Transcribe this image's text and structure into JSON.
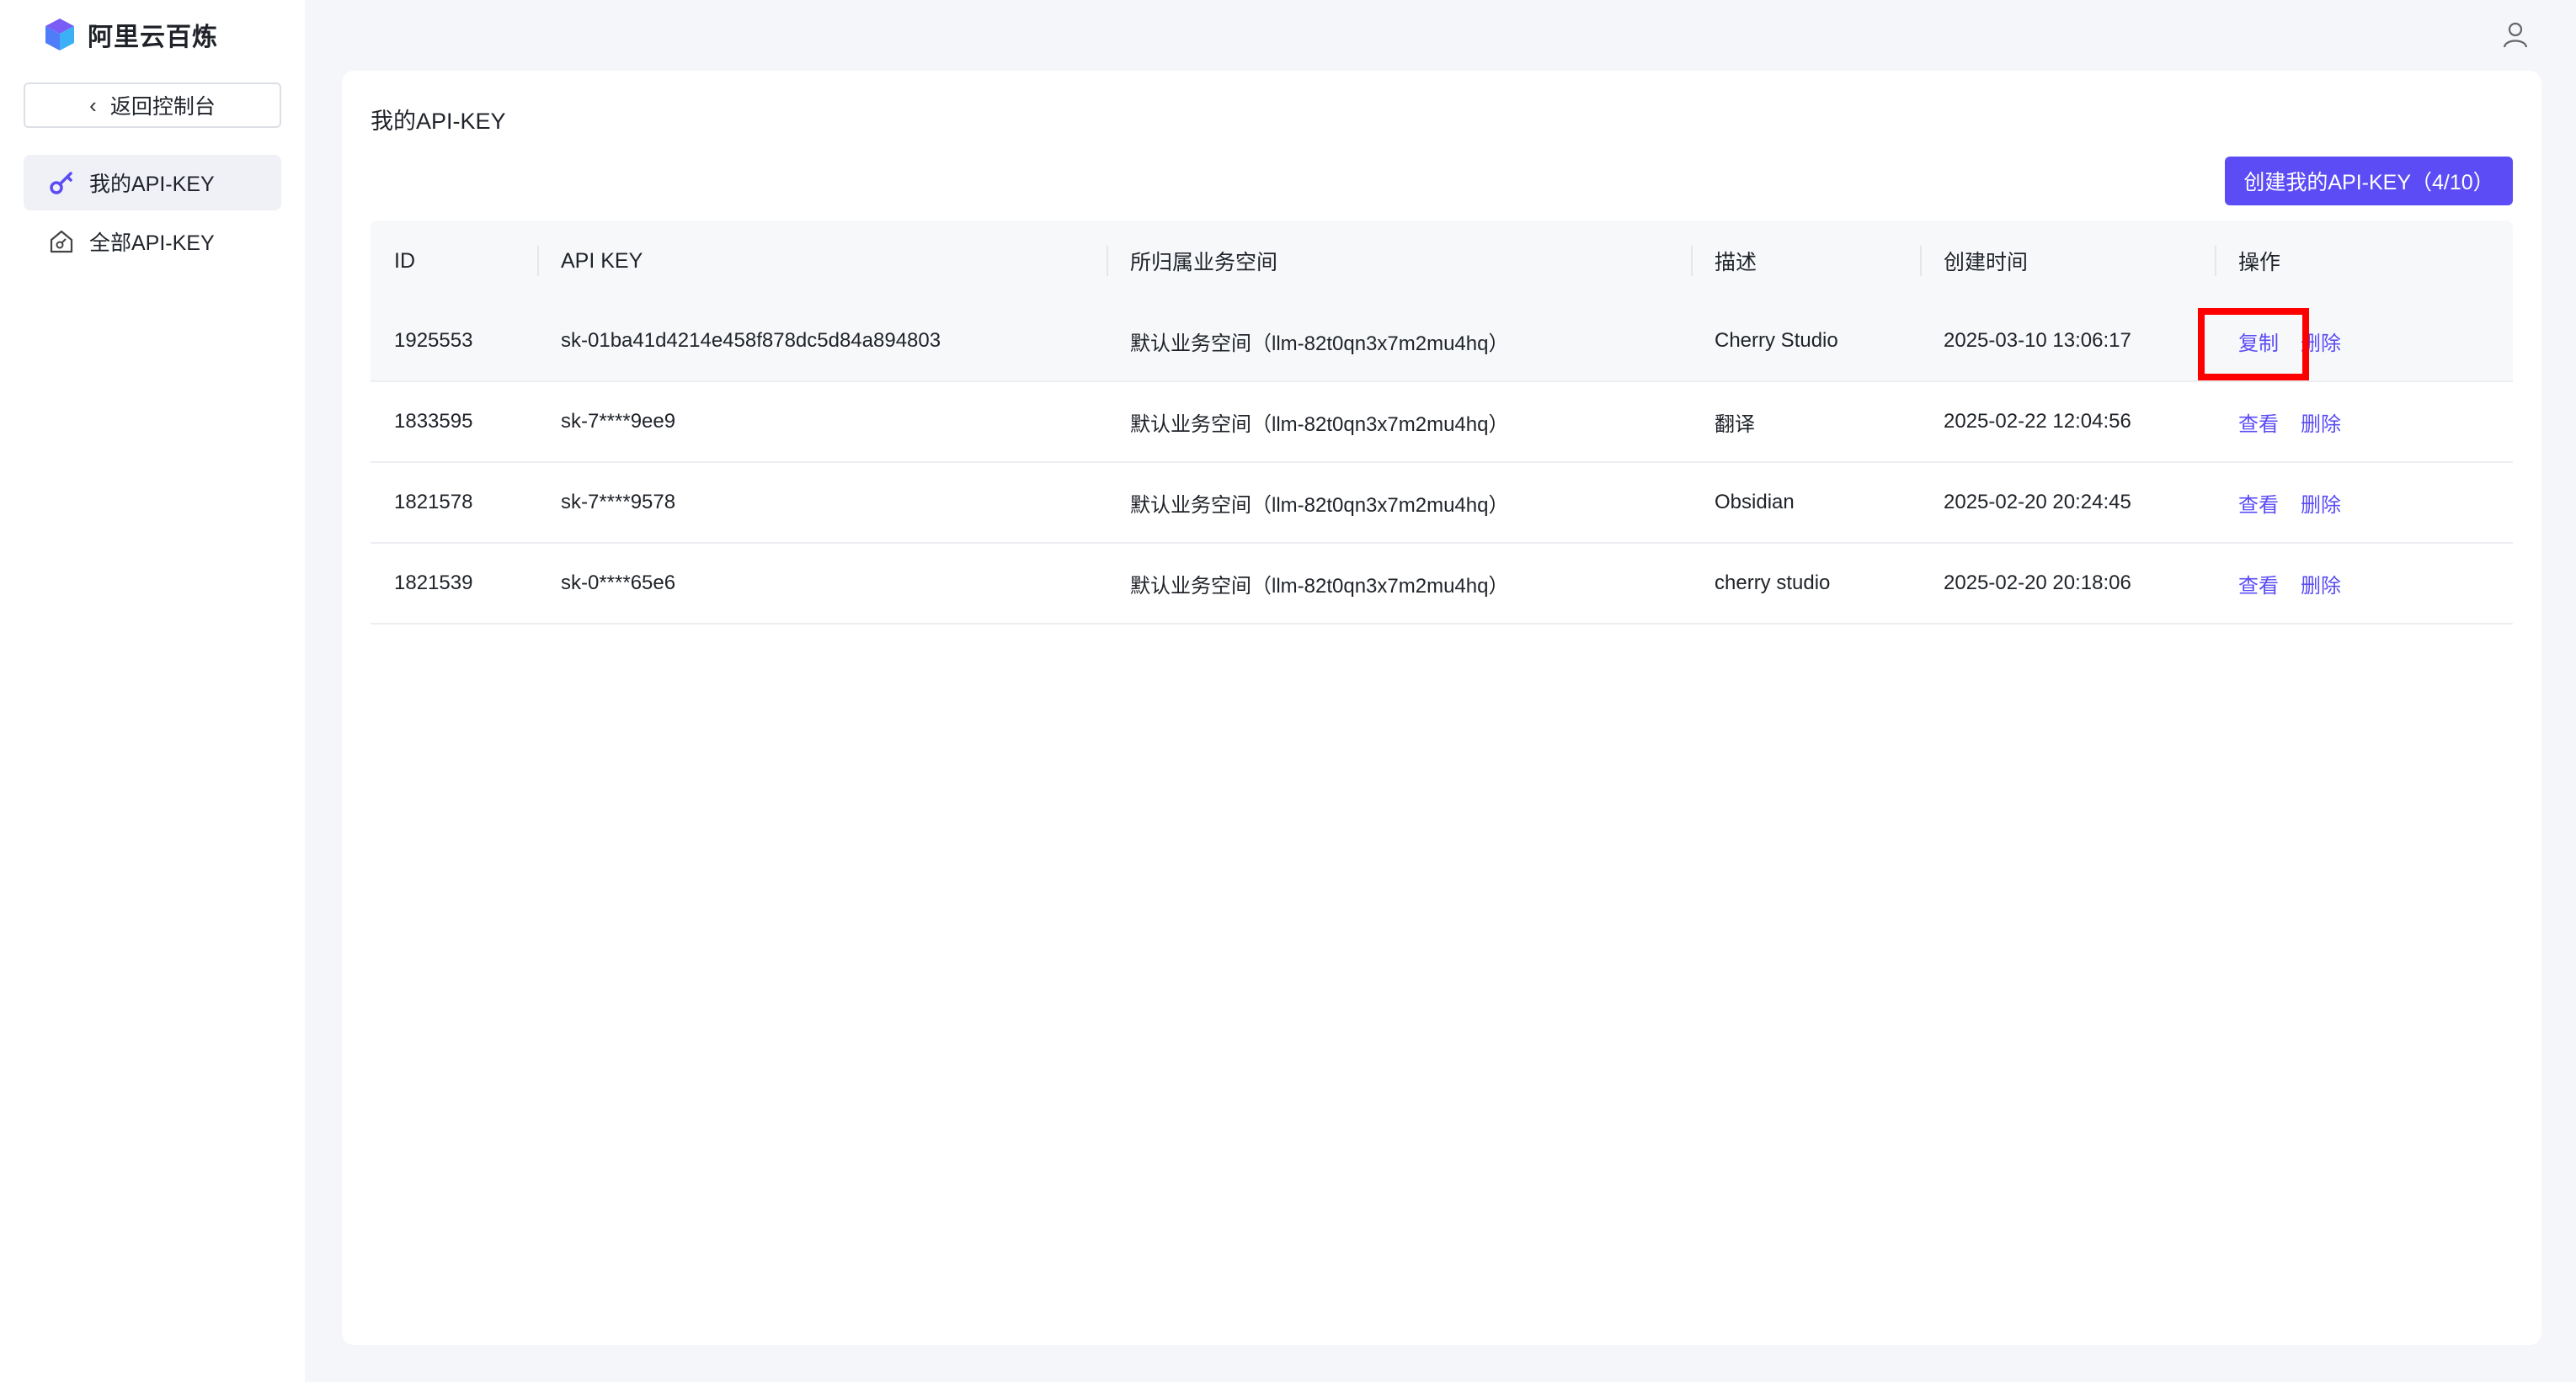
{
  "brand": {
    "name": "阿里云百炼"
  },
  "sidebar": {
    "back_label": "返回控制台",
    "items": [
      {
        "label": "我的API-KEY",
        "icon": "key-icon",
        "active": true
      },
      {
        "label": "全部API-KEY",
        "icon": "home-key-icon",
        "active": false
      }
    ]
  },
  "header": {
    "user_icon": "user-icon"
  },
  "main": {
    "title": "我的API-KEY",
    "create_button": "创建我的API-KEY（4/10）",
    "table": {
      "columns": [
        "ID",
        "API KEY",
        "所归属业务空间",
        "描述",
        "创建时间",
        "操作"
      ],
      "rows": [
        {
          "id": "1925553",
          "key": "sk-01ba41d4214e458f878dc5d84a894803",
          "workspace": "默认业务空间（llm-82t0qn3x7m2mu4hq）",
          "desc": "Cherry Studio",
          "created": "2025-03-10 13:06:17",
          "action1": "复制",
          "action2": "删除"
        },
        {
          "id": "1833595",
          "key": "sk-7****9ee9",
          "workspace": "默认业务空间（llm-82t0qn3x7m2mu4hq）",
          "desc": "翻译",
          "created": "2025-02-22 12:04:56",
          "action1": "查看",
          "action2": "删除"
        },
        {
          "id": "1821578",
          "key": "sk-7****9578",
          "workspace": "默认业务空间（llm-82t0qn3x7m2mu4hq）",
          "desc": "Obsidian",
          "created": "2025-02-20 20:24:45",
          "action1": "查看",
          "action2": "删除"
        },
        {
          "id": "1821539",
          "key": "sk-0****65e6",
          "workspace": "默认业务空间（llm-82t0qn3x7m2mu4hq）",
          "desc": "cherry studio",
          "created": "2025-02-20 20:18:06",
          "action1": "查看",
          "action2": "删除"
        }
      ]
    }
  },
  "colors": {
    "accent": "#5b4cf5",
    "highlight": "#ff0000"
  }
}
